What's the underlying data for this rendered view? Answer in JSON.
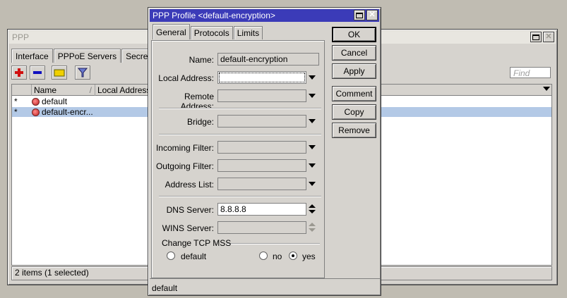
{
  "ppp_window": {
    "title": "PPP",
    "tabs": [
      "Interface",
      "PPPoE Servers",
      "Secrets"
    ],
    "toolbar": {
      "add_icon": "plus-icon",
      "remove_icon": "minus-icon",
      "comment_icon": "folder-icon",
      "filter_icon": "filter-icon"
    },
    "find_placeholder": "Find",
    "columns": [
      "",
      "Name",
      "Local Address"
    ],
    "rows": [
      {
        "mark": "*",
        "name": "default"
      },
      {
        "mark": "*",
        "name": "default-encr..."
      }
    ],
    "status": "2 items (1 selected)"
  },
  "dialog": {
    "title": "PPP Profile <default-encryption>",
    "tabs": [
      "General",
      "Protocols",
      "Limits"
    ],
    "fields": {
      "name": {
        "label": "Name:",
        "value": "default-encryption"
      },
      "local_address": {
        "label": "Local Address:",
        "value": ""
      },
      "remote_address": {
        "label": "Remote Address:",
        "value": ""
      },
      "bridge": {
        "label": "Bridge:",
        "value": ""
      },
      "incoming_filter": {
        "label": "Incoming Filter:",
        "value": ""
      },
      "outgoing_filter": {
        "label": "Outgoing Filter:",
        "value": ""
      },
      "address_list": {
        "label": "Address List:",
        "value": ""
      },
      "dns_server": {
        "label": "DNS Server:",
        "value": "8.8.8.8"
      },
      "wins_server": {
        "label": "WINS Server:",
        "value": ""
      }
    },
    "tcp_mss": {
      "group_label": "Change TCP MSS",
      "options": [
        "default",
        "no",
        "yes"
      ],
      "selected": "yes"
    },
    "buttons": {
      "ok": "OK",
      "cancel": "Cancel",
      "apply": "Apply",
      "comment": "Comment",
      "copy": "Copy",
      "remove": "Remove"
    },
    "status": "default"
  },
  "colors": {
    "active_title": "#3b3bb8",
    "selected_row": "#b3c9e6",
    "window_bg": "#d6d3ce"
  }
}
